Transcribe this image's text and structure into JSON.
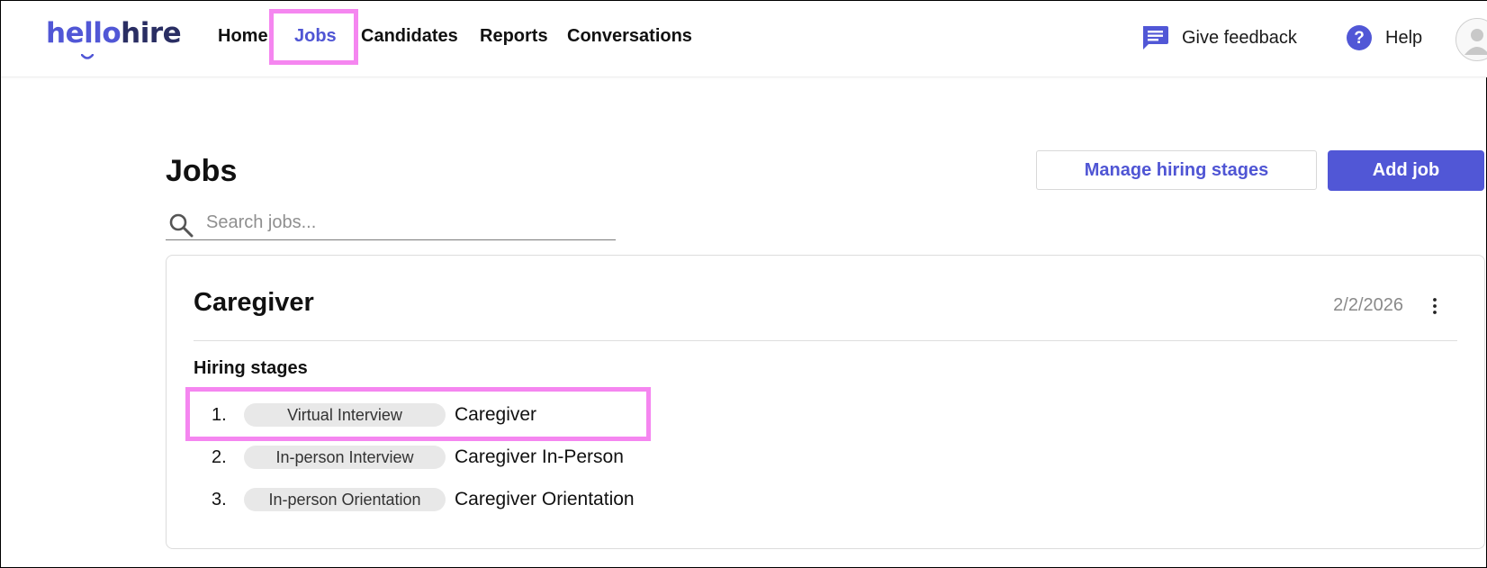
{
  "header": {
    "logo_part1": "hello",
    "logo_part2": "hire",
    "nav": [
      {
        "label": "Home",
        "active": false
      },
      {
        "label": "Jobs",
        "active": true
      },
      {
        "label": "Candidates",
        "active": false
      },
      {
        "label": "Reports",
        "active": false
      },
      {
        "label": "Conversations",
        "active": false
      }
    ],
    "feedback_label": "Give feedback",
    "help_label": "Help",
    "feedback_icon": "chat-bubble-icon",
    "help_icon": "question-circle-icon",
    "avatar_icon": "user-avatar-icon"
  },
  "main": {
    "title": "Jobs",
    "manage_button": "Manage hiring stages",
    "add_button": "Add job",
    "search_placeholder": "Search jobs...",
    "search_icon": "magnifier-icon"
  },
  "jobs": [
    {
      "title": "Caregiver",
      "date": "2/2/2026",
      "stages_heading": "Hiring stages",
      "stages": [
        {
          "number": "1.",
          "type": "Virtual Interview",
          "name": "Caregiver"
        },
        {
          "number": "2.",
          "type": "In-person Interview",
          "name": "Caregiver In-Person"
        },
        {
          "number": "3.",
          "type": "In-person Orientation",
          "name": "Caregiver Orientation"
        }
      ]
    }
  ],
  "colors": {
    "accent": "#5157d6",
    "brand_dark": "#2a2e63",
    "highlight": "#f586f0",
    "pill_bg": "#e8e8e8"
  }
}
